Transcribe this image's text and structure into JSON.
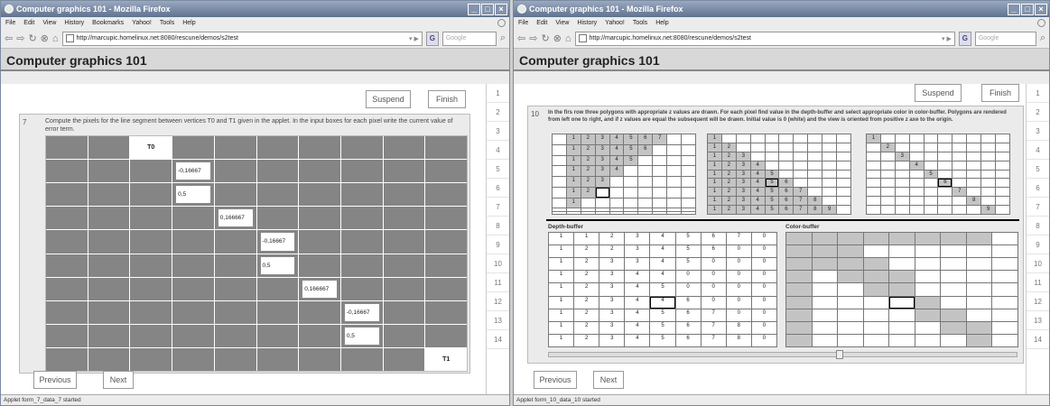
{
  "window1": {
    "title": "Computer graphics 101 - Mozilla Firefox",
    "menu": [
      "File",
      "Edit",
      "View",
      "History",
      "Bookmarks",
      "Yahoo!",
      "Tools",
      "Help"
    ],
    "url": "http://marcupic.homelinux.net:8080/rescune/demos/s2test",
    "search_placeholder": "Google",
    "app_title": "Computer graphics 101",
    "suspend": "Suspend",
    "finish": "Finish",
    "pages": [
      "1",
      "2",
      "3",
      "4",
      "5",
      "6",
      "7",
      "8",
      "9",
      "10",
      "11",
      "12",
      "13",
      "14"
    ],
    "question_number": "7",
    "question_text": "Compute the pixels for the line segment between vertices T0 and T1 given in the applet. In the input boxes for each pixel write the current value of error term.",
    "grid": {
      "labels": [
        {
          "row": 0,
          "col": 2,
          "text": "T0"
        },
        {
          "row": 9,
          "col": 9,
          "text": "T1"
        }
      ],
      "inputs": [
        {
          "row": 1,
          "col": 3,
          "value": "-0,16667"
        },
        {
          "row": 2,
          "col": 3,
          "value": "0,5"
        },
        {
          "row": 3,
          "col": 4,
          "value": "0,166667"
        },
        {
          "row": 4,
          "col": 5,
          "value": "-0,16667"
        },
        {
          "row": 5,
          "col": 5,
          "value": "0,5"
        },
        {
          "row": 6,
          "col": 6,
          "value": "0,166667"
        },
        {
          "row": 7,
          "col": 7,
          "value": "-0,16667"
        },
        {
          "row": 8,
          "col": 7,
          "value": "0,5"
        }
      ]
    },
    "previous": "Previous",
    "next": "Next",
    "status": "Applet form_7_data_7 started"
  },
  "window2": {
    "title": "Computer graphics 101 - Mozilla Firefox",
    "menu": [
      "File",
      "Edit",
      "View",
      "History",
      "Yahoo!",
      "Tools",
      "Help"
    ],
    "url": "http://marcupic.homelinux.net:8080/rescune/demos/s2test",
    "search_placeholder": "Google",
    "app_title": "Computer graphics 101",
    "suspend": "Suspend",
    "finish": "Finish",
    "pages": [
      "1",
      "2",
      "3",
      "4",
      "5",
      "6",
      "7",
      "8",
      "9",
      "10",
      "11",
      "12",
      "13",
      "14"
    ],
    "question_number": "10",
    "question_text": "In the firs row three polygons with appropriate z values are drawn. For each pixel find value in the depth-buffer and select appropriate color in color-buffer. Polygons are rendered from left one to right, and if z values are equal the subsequent will be drawn. Initial value is 0 (white) and the view is oriented from positive z axe to the origin.",
    "poly1": [
      [
        "",
        "1",
        "2",
        "3",
        "4",
        "5",
        "6",
        "7",
        "",
        ""
      ],
      [
        "",
        "1",
        "2",
        "3",
        "4",
        "5",
        "6",
        "",
        "",
        ""
      ],
      [
        "",
        "1",
        "2",
        "3",
        "4",
        "5",
        "",
        "",
        "",
        ""
      ],
      [
        "",
        "1",
        "2",
        "3",
        "4",
        "",
        "",
        "",
        "",
        ""
      ],
      [
        "",
        "1",
        "2",
        "3",
        "",
        "",
        "",
        "",
        "",
        ""
      ],
      [
        "",
        "1",
        "2",
        "",
        "",
        "",
        "",
        "",
        "",
        ""
      ],
      [
        "",
        "1",
        "",
        "",
        "",
        "",
        "",
        "",
        "",
        ""
      ],
      [
        "",
        "",
        "",
        "",
        "",
        "",
        "",
        "",
        "",
        ""
      ],
      [
        "",
        "",
        "",
        "",
        "",
        "",
        "",
        "",
        "",
        ""
      ]
    ],
    "poly2": [
      [
        "1",
        "",
        "",
        "",
        "",
        "",
        "",
        "",
        "",
        ""
      ],
      [
        "1",
        "2",
        "",
        "",
        "",
        "",
        "",
        "",
        "",
        ""
      ],
      [
        "1",
        "2",
        "3",
        "",
        "",
        "",
        "",
        "",
        "",
        ""
      ],
      [
        "1",
        "2",
        "3",
        "4",
        "",
        "",
        "",
        "",
        "",
        ""
      ],
      [
        "1",
        "2",
        "3",
        "4",
        "5",
        "",
        "",
        "",
        "",
        ""
      ],
      [
        "1",
        "2",
        "3",
        "4",
        "5",
        "6",
        "",
        "",
        "",
        ""
      ],
      [
        "1",
        "2",
        "3",
        "4",
        "5",
        "6",
        "7",
        "",
        "",
        ""
      ],
      [
        "1",
        "2",
        "3",
        "4",
        "5",
        "6",
        "7",
        "8",
        "",
        ""
      ],
      [
        "1",
        "2",
        "3",
        "4",
        "5",
        "6",
        "7",
        "8",
        "9",
        ""
      ]
    ],
    "poly3": [
      [
        "1",
        "",
        "",
        "",
        "",
        "",
        "",
        "",
        "",
        ""
      ],
      [
        "",
        "2",
        "",
        "",
        "",
        "",
        "",
        "",
        "",
        ""
      ],
      [
        "",
        "",
        "3",
        "",
        "",
        "",
        "",
        "",
        "",
        ""
      ],
      [
        "",
        "",
        "",
        "4",
        "",
        "",
        "",
        "",
        "",
        ""
      ],
      [
        "",
        "",
        "",
        "",
        "5",
        "",
        "",
        "",
        "",
        ""
      ],
      [
        "",
        "",
        "",
        "",
        "",
        "6",
        "",
        "",
        "",
        ""
      ],
      [
        "",
        "",
        "",
        "",
        "",
        "",
        "7",
        "",
        "",
        ""
      ],
      [
        "",
        "",
        "",
        "",
        "",
        "",
        "",
        "8",
        "",
        ""
      ],
      [
        "",
        "",
        "",
        "",
        "",
        "",
        "",
        "",
        "9",
        ""
      ]
    ],
    "depth_label": "Depth-buffer",
    "color_label": "Color-buffer",
    "depth": [
      [
        "1",
        "1",
        "2",
        "3",
        "4",
        "5",
        "6",
        "7",
        "0"
      ],
      [
        "1",
        "2",
        "2",
        "3",
        "4",
        "5",
        "6",
        "0",
        "0"
      ],
      [
        "1",
        "2",
        "3",
        "3",
        "4",
        "5",
        "0",
        "0",
        "0"
      ],
      [
        "1",
        "2",
        "3",
        "4",
        "4",
        "0",
        "0",
        "0",
        "0"
      ],
      [
        "1",
        "2",
        "3",
        "4",
        "5",
        "0",
        "0",
        "0",
        "0"
      ],
      [
        "1",
        "2",
        "3",
        "4",
        "4",
        "6",
        "0",
        "0",
        "0"
      ],
      [
        "1",
        "2",
        "3",
        "4",
        "5",
        "6",
        "7",
        "0",
        "0"
      ],
      [
        "1",
        "2",
        "3",
        "4",
        "5",
        "6",
        "7",
        "8",
        "0"
      ],
      [
        "1",
        "2",
        "3",
        "4",
        "5",
        "6",
        "7",
        "8",
        "0"
      ]
    ],
    "previous": "Previous",
    "next": "Next",
    "status": "Applet form_10_data_10 started"
  }
}
